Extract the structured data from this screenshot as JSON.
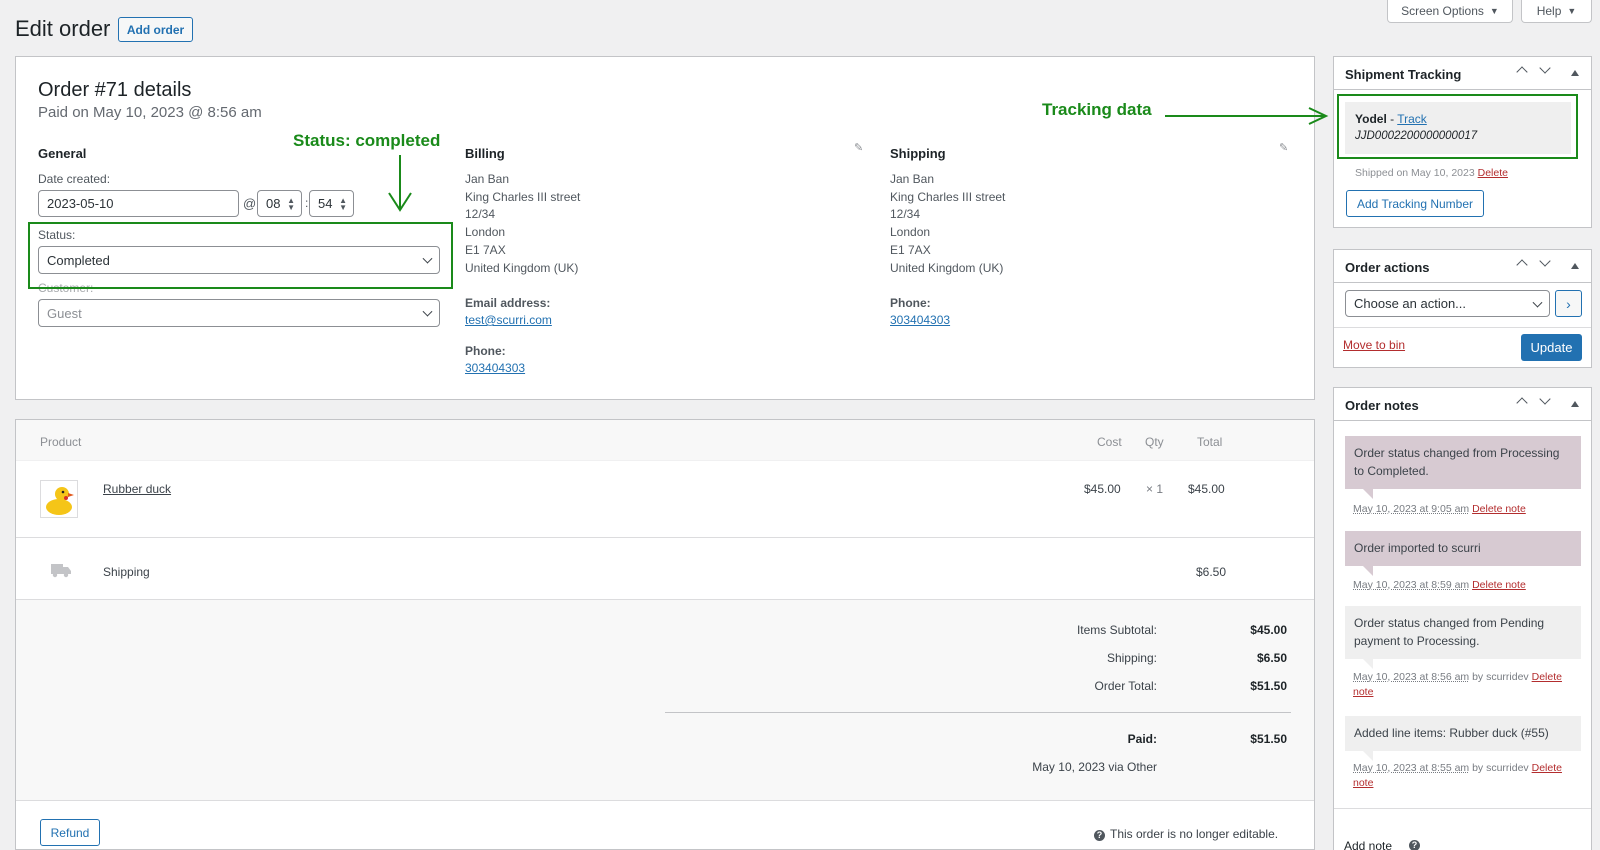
{
  "top": {
    "screen_options": "Screen Options",
    "help": "Help"
  },
  "header": {
    "title": "Edit order",
    "add_order": "Add order"
  },
  "order": {
    "title": "Order #71 details",
    "subtitle": "Paid on May 10, 2023 @ 8:56 am",
    "general": {
      "heading": "General",
      "date_label": "Date created:",
      "date_value": "2023-05-10",
      "at": "@",
      "hour": "08",
      "colon": ":",
      "minute": "54",
      "status_label": "Status:",
      "status_value": "Completed",
      "customer_label": "Customer:",
      "customer_value": "Guest"
    },
    "billing": {
      "heading": "Billing",
      "lines": [
        "Jan Ban",
        "King Charles III street",
        "12/34",
        "London",
        "E1 7AX",
        "United Kingdom (UK)"
      ],
      "email_label": "Email address:",
      "email": "test@scurri.com",
      "phone_label": "Phone:",
      "phone": "303404303"
    },
    "shipping": {
      "heading": "Shipping",
      "lines": [
        "Jan Ban",
        "King Charles III street",
        "12/34",
        "London",
        "E1 7AX",
        "United Kingdom (UK)"
      ],
      "phone_label": "Phone:",
      "phone": "303404303"
    }
  },
  "annotations": {
    "status": "Status: completed",
    "tracking": "Tracking data"
  },
  "items": {
    "headers": {
      "product": "Product",
      "cost": "Cost",
      "qty": "Qty",
      "total": "Total"
    },
    "product": {
      "name": "Rubber duck",
      "cost": "$45.00",
      "qty": "× 1",
      "total": "$45.00"
    },
    "shipping": {
      "name": "Shipping",
      "total": "$6.50"
    },
    "totals": {
      "subtotal_label": "Items Subtotal:",
      "subtotal": "$45.00",
      "shipping_label": "Shipping:",
      "shipping": "$6.50",
      "total_label": "Order Total:",
      "total": "$51.50",
      "paid_label": "Paid:",
      "paid": "$51.50",
      "paid_note": "May 10, 2023 via Other"
    },
    "refund": "Refund",
    "not_editable": "This order is no longer editable."
  },
  "tracking": {
    "title": "Shipment Tracking",
    "carrier": "Yodel",
    "sep": " - ",
    "track": "Track",
    "number": "JJD0002200000000017",
    "shipped": "Shipped on May 10, 2023",
    "delete": "Delete",
    "add": "Add Tracking Number"
  },
  "actions": {
    "title": "Order actions",
    "select": "Choose an action...",
    "move_to_bin": "Move to bin",
    "update": "Update"
  },
  "notes": {
    "title": "Order notes",
    "items": [
      {
        "text": "Order status changed from Processing to Completed.",
        "date": "May 10, 2023 at 9:05 am",
        "by": "",
        "delete": "Delete note"
      },
      {
        "text": "Order imported to scurri",
        "date": "May 10, 2023 at 8:59 am",
        "by": "",
        "delete": "Delete note"
      },
      {
        "text": "Order status changed from Pending payment to Processing.",
        "date": "May 10, 2023 at 8:56 am",
        "by": "by scurridev",
        "delete": "Delete note"
      },
      {
        "text": "Added line items: Rubber duck (#55)",
        "date": "May 10, 2023 at 8:55 am",
        "by": "by scurridev",
        "delete": "Delete note"
      }
    ],
    "add_note": "Add note"
  },
  "colors": {
    "accent": "#2271b1",
    "annotation": "#1a8a1a",
    "system_note": "#d7cad2",
    "danger": "#b32d2e"
  },
  "icons": [
    "chevron-down-icon",
    "chevron-up-icon",
    "pencil-icon",
    "truck-icon",
    "help-icon",
    "duck-thumbnail"
  ]
}
